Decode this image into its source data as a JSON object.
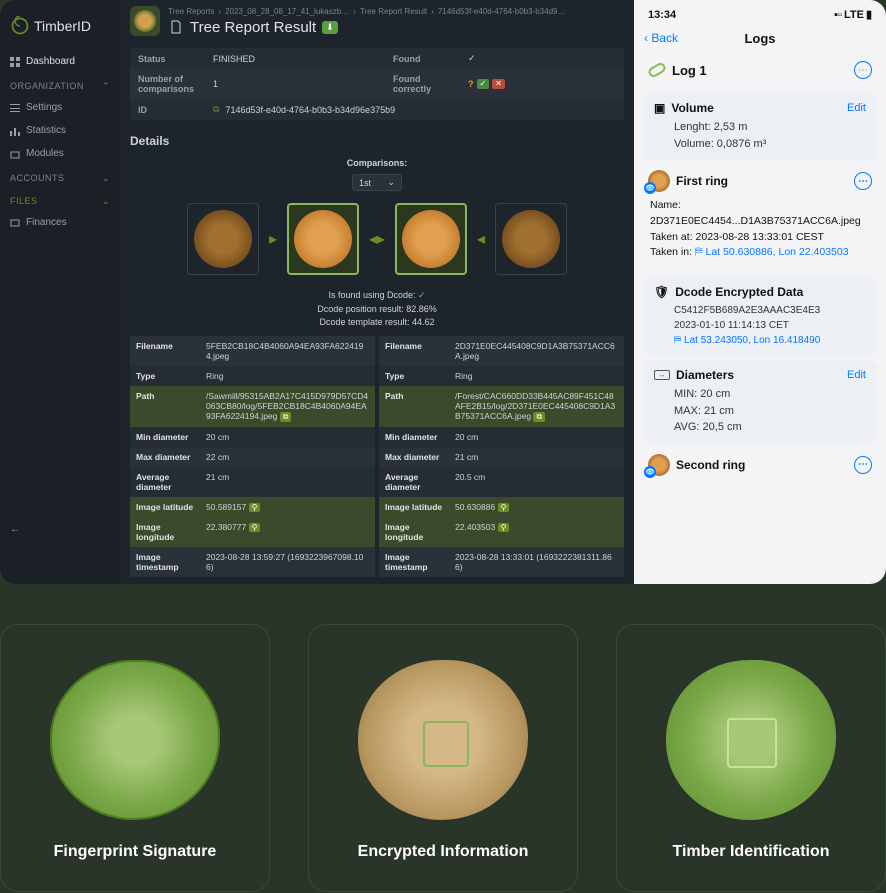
{
  "brand": "TimberID",
  "nav": {
    "dashboard": "Dashboard",
    "org_head": "ORGANIZATION",
    "settings": "Settings",
    "statistics": "Statistics",
    "modules": "Modules",
    "accounts_head": "ACCOUNTS",
    "files_head": "FILES",
    "finances": "Finances"
  },
  "crumbs": {
    "c1": "Tree Reports",
    "c2": "2023_08_28_08_17_41_lukaszb…",
    "c3": "Tree Report Result",
    "c4": "7146d53f-e40d-4764-b0b3-b34d9…"
  },
  "title": "Tree Report Result",
  "status_table": {
    "status_lbl": "Status",
    "status_val": "FINISHED",
    "found_lbl": "Found",
    "num_lbl": "Number of comparisons",
    "num_val": "1",
    "found_correct_lbl": "Found correctly",
    "id_lbl": "ID",
    "id_val": "7146d53f-e40d-4764-b0b3-b34d96e375b9"
  },
  "details_h": "Details",
  "comparisons_h": "Comparisons:",
  "dd_val": "1st",
  "meta": {
    "l1": "Is found using Dcode:",
    "l2_lbl": "Dcode position result:",
    "l2_val": "82.86%",
    "l3_lbl": "Dcode template result:",
    "l3_val": "44.62"
  },
  "left": {
    "filename_lbl": "Filename",
    "filename_val": "5FEB2CB18C4B4060A94EA93FA6224194.jpeg",
    "type_lbl": "Type",
    "type_val": "Ring",
    "path_lbl": "Path",
    "path_val": "/Sawmill/95315AB2A17C415D979D57CD4063CB80/log/5FEB2CB18C4B4060A94EA93FA6224194.jpeg",
    "min_lbl": "Min diameter",
    "min_val": "20 cm",
    "max_lbl": "Max diameter",
    "max_val": "22 cm",
    "avg_lbl": "Average diameter",
    "avg_val": "21 cm",
    "lat_lbl": "Image latitude",
    "lat_val": "50.589157",
    "lon_lbl": "Image longitude",
    "lon_val": "22.380777",
    "ts_lbl": "Image timestamp",
    "ts_val": "2023-08-28 13:59:27 (1693223967098.106)"
  },
  "right": {
    "filename_lbl": "Filename",
    "filename_val": "2D371E0EC445408C9D1A3B75371ACC6A.jpeg",
    "type_lbl": "Type",
    "type_val": "Ring",
    "path_lbl": "Path",
    "path_val": "/Forest/CAC660DD33B445AC89F451C48AFE2B15/log/2D371E0EC445408C9D1A3B75371ACC6A.jpeg",
    "min_lbl": "Min diameter",
    "min_val": "20 cm",
    "max_lbl": "Max diameter",
    "max_val": "21 cm",
    "avg_lbl": "Average diameter",
    "avg_val": "20.5 cm",
    "lat_lbl": "Image latitude",
    "lat_val": "50.630886",
    "lon_lbl": "Image longitude",
    "lon_val": "22.403503",
    "ts_lbl": "Image timestamp",
    "ts_val": "2023-08-28 13:33:01 (1693222381311.866)"
  },
  "mobile": {
    "time": "13:34",
    "net": "LTE",
    "back": "Back",
    "title": "Logs",
    "log1": "Log 1",
    "volume_h": "Volume",
    "edit": "Edit",
    "len": "Lenght: 2,53 m",
    "vol": "Volume: 0,0876 m³",
    "first_ring": "First ring",
    "name": "Name: 2D371E0EC4454...D1A3B75371ACC6A.jpeg",
    "taken_at": "Taken at: 2023-08-28 13:33:01 CEST",
    "taken_in_lbl": "Taken in:",
    "taken_in_loc": "Lat 50.630886, Lon 22.403503",
    "dcode_h": "Dcode Encrypted Data",
    "dcode_id": "C5412F5B689A2E3AAAC3E4E3",
    "dcode_ts": "2023-01-10 11:14:13 CET",
    "dcode_loc": "Lat 53.243050, Lon 16.418490",
    "dia_h": "Diameters",
    "dia_min": "MIN: 20 cm",
    "dia_max": "MAX: 21 cm",
    "dia_avg": "AVG: 20,5 cm",
    "second_ring": "Second ring"
  },
  "features": {
    "f1": "Fingerprint Signature",
    "f2": "Encrypted Information",
    "f3": "Timber Identification"
  }
}
